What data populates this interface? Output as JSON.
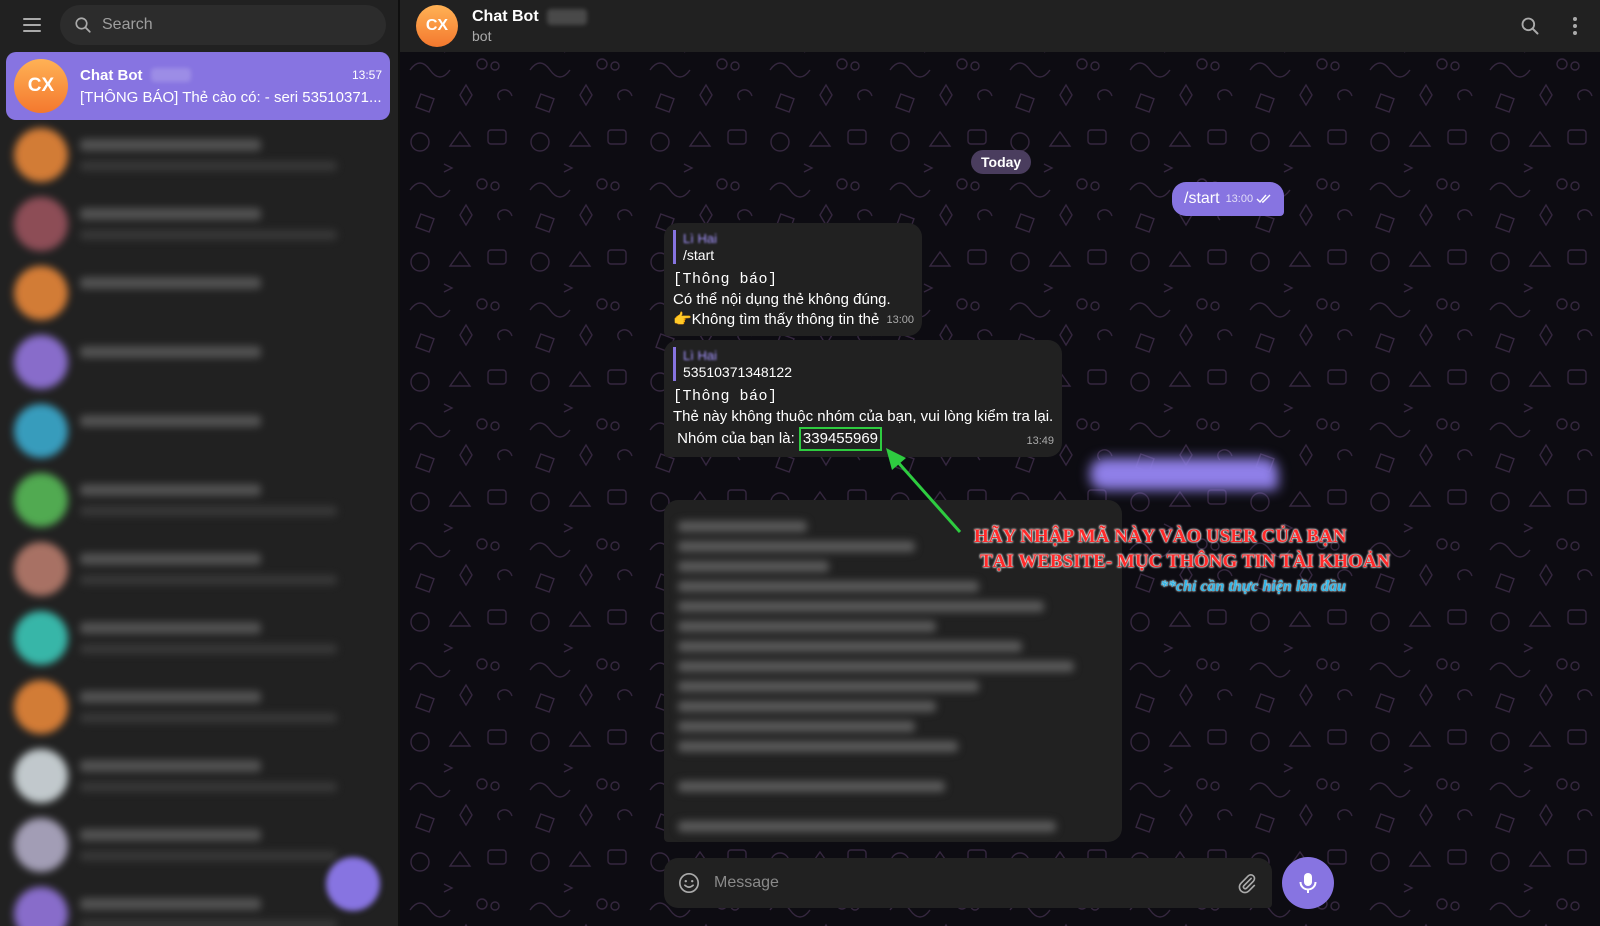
{
  "sidebar": {
    "search_placeholder": "Search",
    "active_chat": {
      "avatar_initials": "CX",
      "title": "Chat Bot",
      "time": "13:57",
      "preview": "[THÔNG BÁO] Thẻ cào có: - seri 53510371..."
    }
  },
  "header": {
    "avatar_initials": "CX",
    "title": "Chat Bot",
    "subtitle": "bot"
  },
  "conversation": {
    "date_label": "Today",
    "outgoing_start": {
      "text": "/start",
      "time": "13:00"
    },
    "message1": {
      "reply_name": "Lì Hai",
      "reply_text": "/start",
      "line1": "[Thông báo]",
      "line2": "Có thể nội dụng thẻ không đúng.",
      "line3": "👉Không tìm thấy thông tin thẻ",
      "time": "13:00"
    },
    "message2": {
      "reply_name": "Lì Hai",
      "reply_text": "53510371348122",
      "line1": "[Thông báo]",
      "line2": "Thẻ này không thuộc nhóm của bạn, vui lòng kiểm tra lại.",
      "group_label": "Nhóm của bạn là:",
      "group_code": "339455969",
      "time": "13:49"
    }
  },
  "annotation": {
    "line1": "HÃY NHẬP MÃ NÀY VÀO USER CỦA BẠN",
    "line2": "TẠI WEBSITE- MỤC THÔNG TIN TÀI KHOẢN",
    "note": "**chỉ cần thực hiện lần đầu",
    "text_color": "#ff2a2a",
    "note_color": "#2fb6e8",
    "arrow_color": "#2ecc40"
  },
  "composer": {
    "placeholder": "Message"
  },
  "colors": {
    "accent": "#8774e1",
    "panel": "#212121",
    "avatar": "#f4782e"
  },
  "icons": [
    "menu-icon",
    "search-icon",
    "kebab-menu-icon",
    "double-check-icon",
    "emoji-icon",
    "attach-icon",
    "microphone-icon"
  ]
}
